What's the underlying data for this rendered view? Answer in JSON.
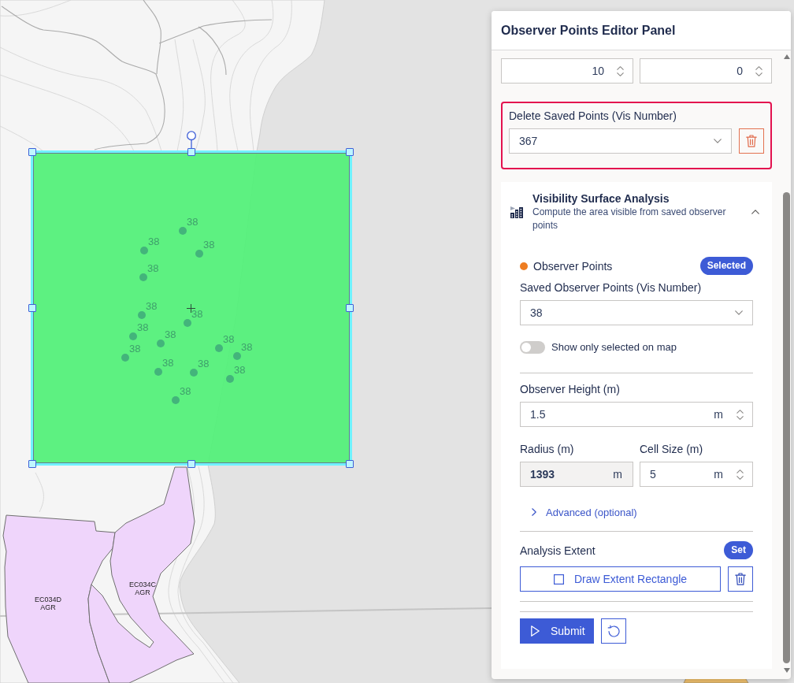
{
  "map": {
    "observer_points": [
      {
        "label": "38"
      },
      {
        "label": "38"
      },
      {
        "label": "38"
      },
      {
        "label": "38"
      },
      {
        "label": "38"
      },
      {
        "label": "38"
      },
      {
        "label": "38"
      },
      {
        "label": "38"
      },
      {
        "label": "38"
      },
      {
        "label": "38"
      },
      {
        "label": "38"
      },
      {
        "label": "38"
      },
      {
        "label": "38"
      },
      {
        "label": "38"
      },
      {
        "label": "38"
      }
    ],
    "parcels": [
      {
        "code": "EC034D",
        "use": "AGR"
      },
      {
        "code": "EC034C",
        "use": "AGR"
      }
    ]
  },
  "panel": {
    "title": "Observer Points Editor Panel",
    "offset_inputs": [
      {
        "value": "10"
      },
      {
        "value": "0"
      }
    ],
    "delete_points": {
      "label": "Delete Saved Points (Vis Number)",
      "value": "367"
    },
    "visibility_analysis": {
      "title": "Visibility Surface Analysis",
      "description": "Compute the area visible from saved observer points",
      "expanded": true,
      "observer_points": {
        "label": "Observer Points",
        "badge": "Selected"
      },
      "saved_points": {
        "label": "Saved Observer Points (Vis Number)",
        "value": "38"
      },
      "show_only_selected": {
        "label": "Show only selected on map",
        "on": false
      },
      "observer_height": {
        "label": "Observer Height (m)",
        "value": "1.5",
        "unit": "m",
        "disabled": false
      },
      "radius": {
        "label": "Radius (m)",
        "value": "1393",
        "unit": "m",
        "disabled": true
      },
      "cell_size": {
        "label": "Cell Size (m)",
        "value": "5",
        "unit": "m",
        "disabled": false
      },
      "advanced": {
        "label": "Advanced (optional)",
        "expanded": false
      },
      "extent": {
        "label": "Analysis Extent",
        "badge": "Set",
        "draw_button": "Draw Extent Rectangle"
      },
      "submit": "Submit"
    }
  }
}
